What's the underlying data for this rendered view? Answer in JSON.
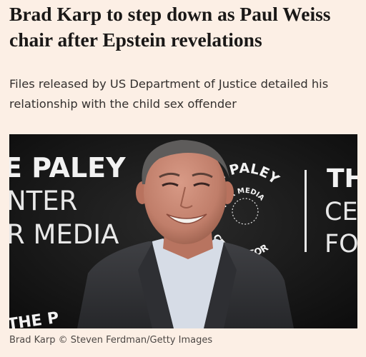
{
  "article": {
    "headline": "Brad Karp to step down as Paul Weiss chair after Epstein revelations",
    "standfirst": "Files released by US Department of Justice detailed his relationship with the child sex offender",
    "caption": "Brad Karp © Steven Ferdman/Getty Images"
  },
  "backdrop": {
    "left_lines": [
      "E PALEY",
      "NTER",
      "R MEDIA"
    ],
    "logo_top_arc": "THE PALEY",
    "logo_middle_arc": "FOR MEDIA",
    "logo_bottom_arc": "CENTER FOR",
    "inner_ring_top": "THE PALEY",
    "right_lines": [
      "TH",
      "CE",
      "FO"
    ],
    "bottom_left_fragment": "THE P"
  },
  "colors": {
    "page_background": "#fcefe5",
    "headline": "#1a1817",
    "backdrop": "#131313",
    "jacket": "#3a3b3f",
    "shirt": "#d8dde7"
  }
}
